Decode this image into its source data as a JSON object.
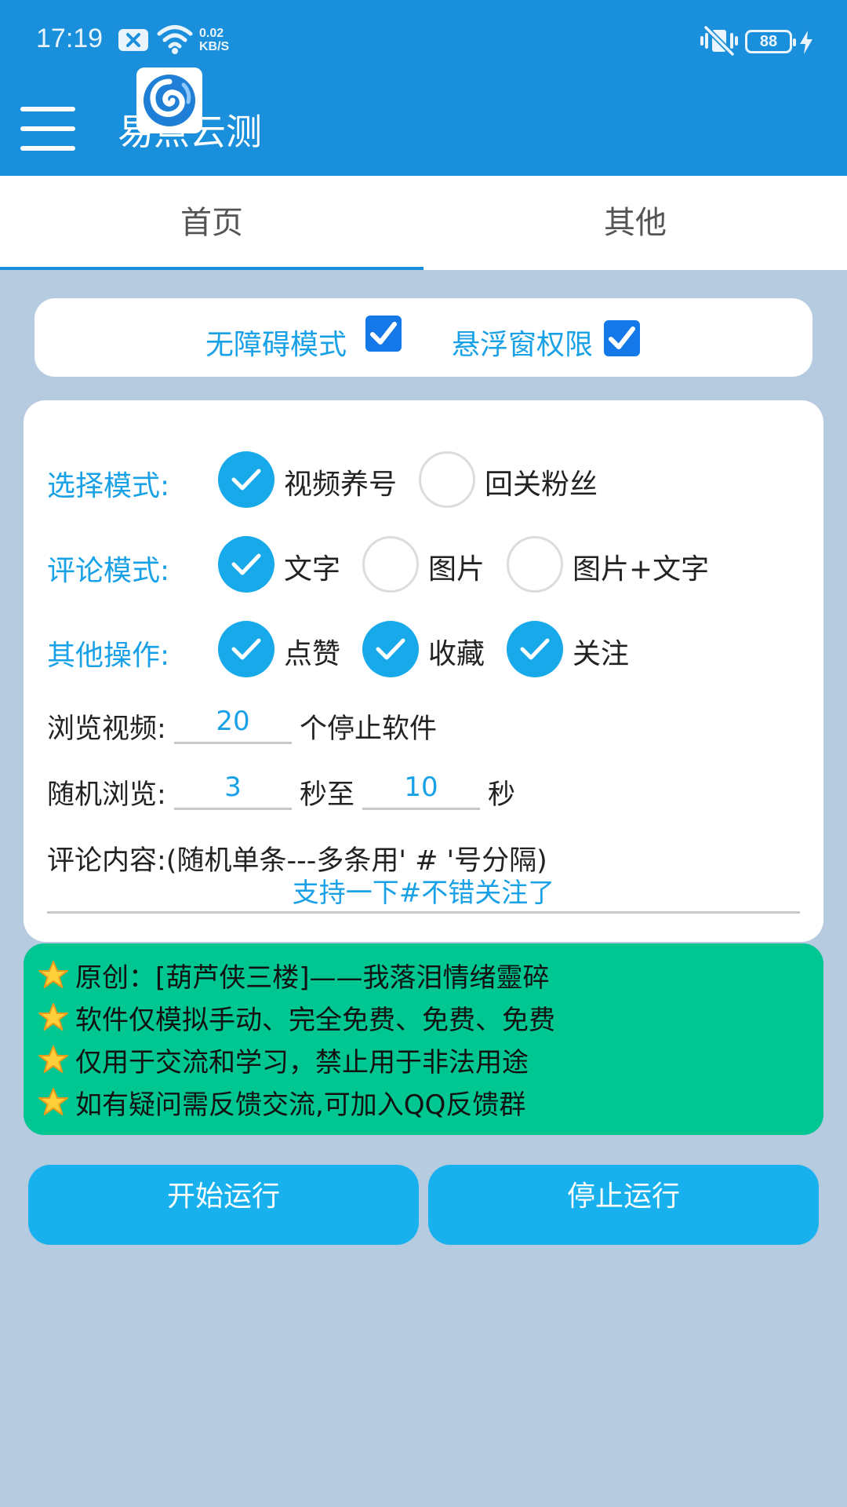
{
  "status_bar": {
    "time": "17:19",
    "net_speed_value": "0.02",
    "net_speed_unit": "KB/S",
    "battery": "88",
    "icons": [
      "notification-x-icon",
      "wifi-icon",
      "vibrate-mute-icon",
      "charging-icon"
    ]
  },
  "app_bar": {
    "title": "易点云测",
    "menu_icon": "hamburger-menu-icon",
    "logo_icon": "app-logo-swirl-icon"
  },
  "tabs": [
    {
      "label": "首页",
      "active": true
    },
    {
      "label": "其他",
      "active": false
    }
  ],
  "permissions": [
    {
      "label": "无障碍模式",
      "checked": true
    },
    {
      "label": "悬浮窗权限",
      "checked": true
    }
  ],
  "settings": {
    "select_mode": {
      "label": "选择模式:",
      "options": [
        {
          "label": "视频养号",
          "selected": true
        },
        {
          "label": "回关粉丝",
          "selected": false
        }
      ]
    },
    "comment_mode": {
      "label": "评论模式:",
      "options": [
        {
          "label": "文字",
          "selected": true
        },
        {
          "label": "图片",
          "selected": false
        },
        {
          "label": "图片+文字",
          "selected": false
        }
      ]
    },
    "other_ops": {
      "label": "其他操作:",
      "options": [
        {
          "label": "点赞",
          "selected": true
        },
        {
          "label": "收藏",
          "selected": true
        },
        {
          "label": "关注",
          "selected": true
        }
      ]
    },
    "browse_videos": {
      "label": "浏览视频:",
      "value": "20",
      "suffix": "个停止软件"
    },
    "random_browse": {
      "label": "随机浏览:",
      "min_value": "3",
      "middle": "秒至",
      "max_value": "10",
      "suffix": "秒"
    },
    "comment_content": {
      "label": "评论内容:(随机单条---多条用' # '号分隔)",
      "value": "支持一下#不错关注了"
    }
  },
  "notice": {
    "icon": "star-icon",
    "lines": [
      "原创：[葫芦侠三楼]——我落泪情绪靈碎",
      "软件仅模拟手动、完全免费、免费、免费",
      "仅用于交流和学习，禁止用于非法用途",
      "如有疑问需反馈交流,可加入QQ反馈群"
    ]
  },
  "buttons": {
    "start": "开始运行",
    "stop": "停止运行"
  },
  "colors": {
    "app_bar": "#1a8fdb",
    "accent": "#18a9ea",
    "background": "#b7cbe0",
    "notice_bg": "#00c692",
    "checkbox": "#1478e8"
  }
}
